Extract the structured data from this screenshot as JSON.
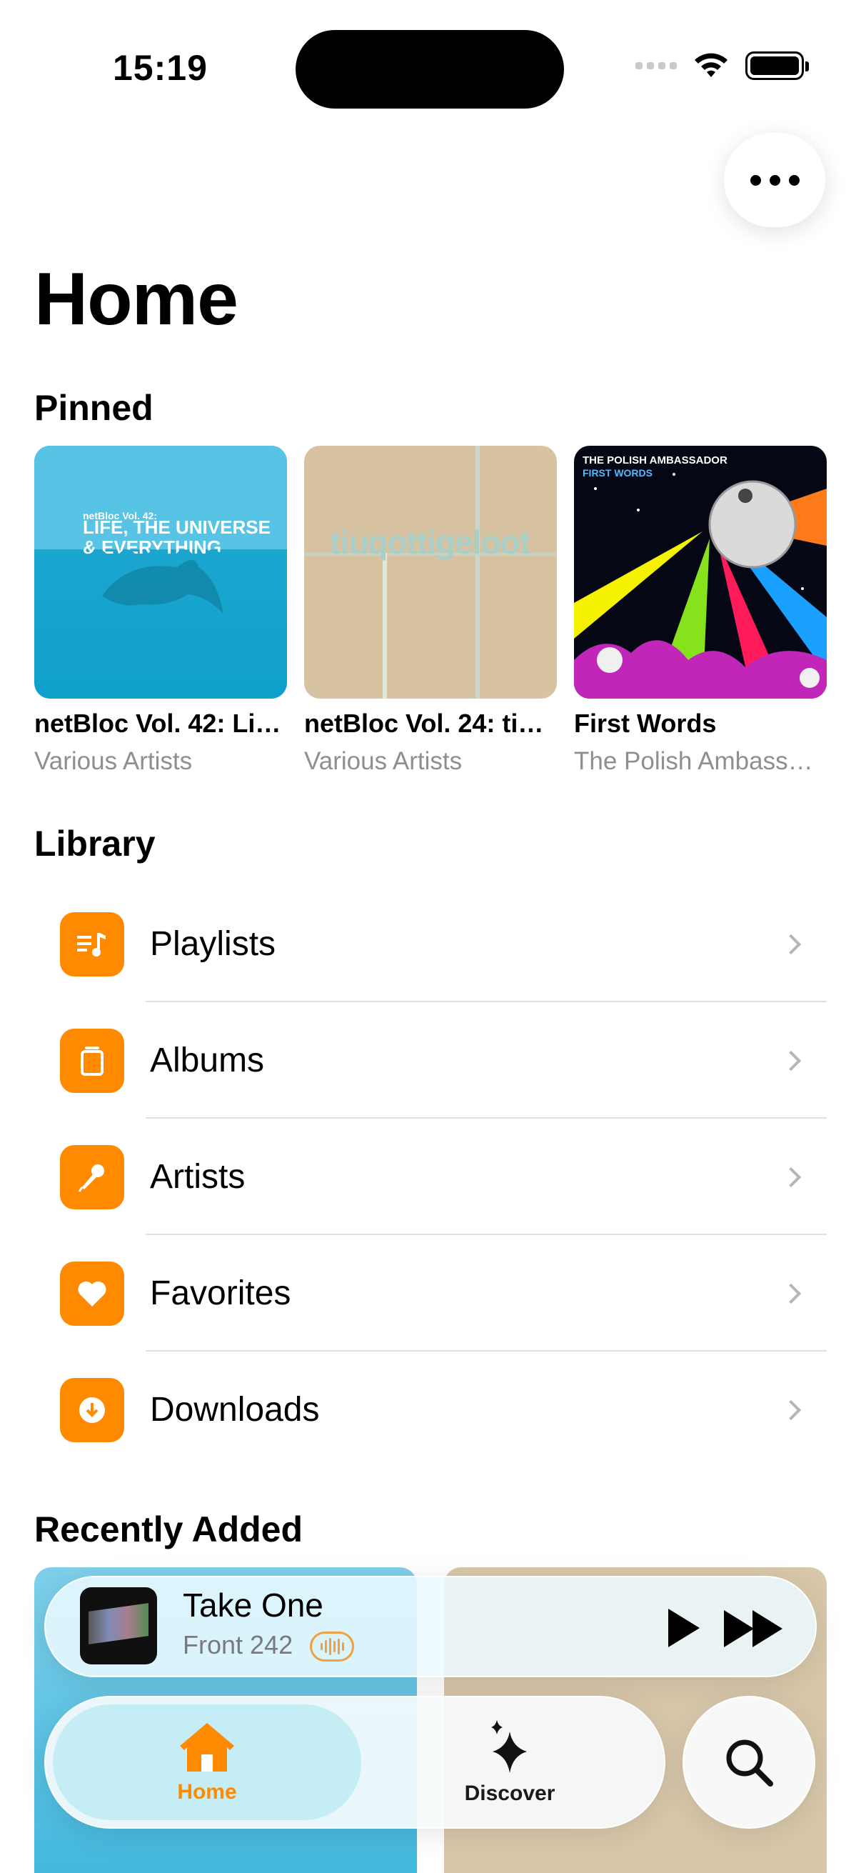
{
  "status_bar": {
    "time": "15:19"
  },
  "header": {
    "title": "Home",
    "more_icon": "ellipsis-icon"
  },
  "pinned": {
    "title": "Pinned",
    "items": [
      {
        "title": "netBloc Vol. 42: Life, The Universe & Everything",
        "subtitle": "Various Artists",
        "art_text_small": "netBloc Vol. 42:",
        "art_text_large": "LIFE, THE UNIVERSE & EVERYTHING"
      },
      {
        "title": "netBloc Vol. 24: tiuqottigeloot",
        "subtitle": "Various Artists",
        "art_text_large": "tiuqottigeloot"
      },
      {
        "title": "First Words",
        "subtitle": "The Polish Ambassador",
        "art_text_small": "THE POLISH AMBASSADOR",
        "art_text_large": "FIRST WORDS"
      }
    ]
  },
  "library": {
    "title": "Library",
    "items": [
      {
        "label": "Playlists",
        "icon": "playlist-icon"
      },
      {
        "label": "Albums",
        "icon": "album-stack-icon"
      },
      {
        "label": "Artists",
        "icon": "microphone-icon"
      },
      {
        "label": "Favorites",
        "icon": "heart-icon"
      },
      {
        "label": "Downloads",
        "icon": "download-icon"
      }
    ]
  },
  "recently_added": {
    "title": "Recently Added"
  },
  "now_playing": {
    "title": "Take One",
    "artist": "Front 242"
  },
  "tab_bar": {
    "tabs": [
      {
        "label": "Home",
        "icon": "house-icon",
        "active": true
      },
      {
        "label": "Discover",
        "icon": "sparkles-icon",
        "active": false
      }
    ],
    "search_icon": "magnifier-icon"
  },
  "colors": {
    "accent": "#ff8a00",
    "secondary_text": "#8e8e93"
  }
}
